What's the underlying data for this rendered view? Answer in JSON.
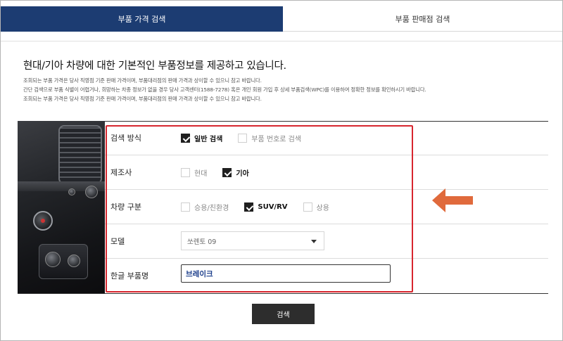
{
  "tabs": [
    {
      "label": "부품 가격 검색",
      "active": true
    },
    {
      "label": "부품 판매점 검색",
      "active": false
    }
  ],
  "headline": "현대/기아 차량에 대한 기본적인 부품정보를 제공하고 있습니다.",
  "notes": [
    "조회되는 부품 가격은 당사 직영점 기준 판매 가격이며, 부품대리점의 판매 가격과 상이할 수 있으니 참고 바랍니다.",
    "간단 검색으로 부품 식별이 어렵거나, 희망하는 차종 정보가 없을 경우 당사 고객센터(1588-7278) 혹은 개인 회원 가입 후 상세 부품검색(WPC)를 이용하여 정확한 정보를 확인하시기 바랍니다.",
    "조회되는 부품 가격은 당사 직영점 기준 판매 가격이며, 부품대리점의 판매 가격과 상이할 수 있으니 참고 바랍니다."
  ],
  "form": {
    "method": {
      "label": "검색 방식",
      "options": [
        {
          "label": "일반 검색",
          "checked": true
        },
        {
          "label": "부품 번호로 검색",
          "checked": false
        }
      ]
    },
    "maker": {
      "label": "제조사",
      "options": [
        {
          "label": "현대",
          "checked": false
        },
        {
          "label": "기아",
          "checked": true
        }
      ]
    },
    "vehicle_type": {
      "label": "차량 구분",
      "options": [
        {
          "label": "승용/친환경",
          "checked": false
        },
        {
          "label": "SUV/RV",
          "checked": true
        },
        {
          "label": "상용",
          "checked": false
        }
      ]
    },
    "model": {
      "label": "모델",
      "selected": "쏘렌토 09"
    },
    "part_name": {
      "label": "한글 부품명",
      "value": "브레이크"
    }
  },
  "search_button": "검색",
  "colors": {
    "tab_active": "#1c3c72",
    "highlight": "#d7262e",
    "arrow": "#e06a3c",
    "button": "#2d2d2d"
  },
  "icons": [
    "checkbox-checked-icon",
    "checkbox-empty-icon",
    "dropdown-caret-icon",
    "left-arrow-icon"
  ]
}
